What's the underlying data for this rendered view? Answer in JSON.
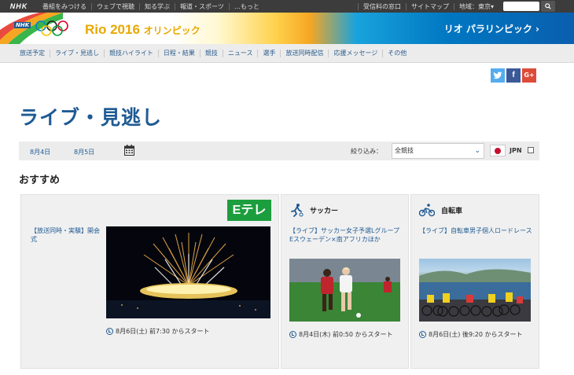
{
  "topbar": {
    "logo": "NHK",
    "links": [
      "番組をみつける",
      "ウェブで視聴",
      "知る学ぶ",
      "報道・スポーツ",
      "…もっと"
    ],
    "right_links": [
      "受信料の窓口",
      "サイトマップ",
      "地域：東京▾"
    ],
    "search_icon": "magnifier-icon"
  },
  "banner": {
    "title": "Rio 2016",
    "title_jp": "オリンピック",
    "paralympic_link": "リオ パラリンピック ›"
  },
  "nav": [
    "放送予定",
    "ライブ・見逃し",
    "競技ハイライト",
    "日程・結果",
    "競技",
    "ニュース",
    "選手",
    "放送同時配信",
    "応援メッセージ",
    "その他"
  ],
  "social": {
    "twitter": "twitter-icon",
    "facebook": "f",
    "google": "G+"
  },
  "page_title": "ライブ・見逃し",
  "datebar": {
    "dates": [
      "8月4日",
      "8月5日"
    ],
    "filter_label": "絞り込み：",
    "filter_value": "全競技",
    "country": "JPN"
  },
  "section_title": "おすすめ",
  "cards": [
    {
      "channel": "Eテレ",
      "title": "【放送同時・実験】開会式",
      "time": "8月6日(土) 前7:30 からスタート"
    },
    {
      "sport": "サッカー",
      "title": "【ライブ】サッカー女子予選Lグループ Eスウェーデン×南アフリカほか",
      "time": "8月4日(木) 前0:50 からスタート"
    },
    {
      "sport": "自転車",
      "title": "【ライブ】自転車男子個人ロードレース",
      "time": "8月6日(土) 後9:20 からスタート"
    }
  ],
  "colors": {
    "accent": "#1e5a93",
    "etele": "#1d9e3e",
    "nav_bg": "#ececec"
  }
}
